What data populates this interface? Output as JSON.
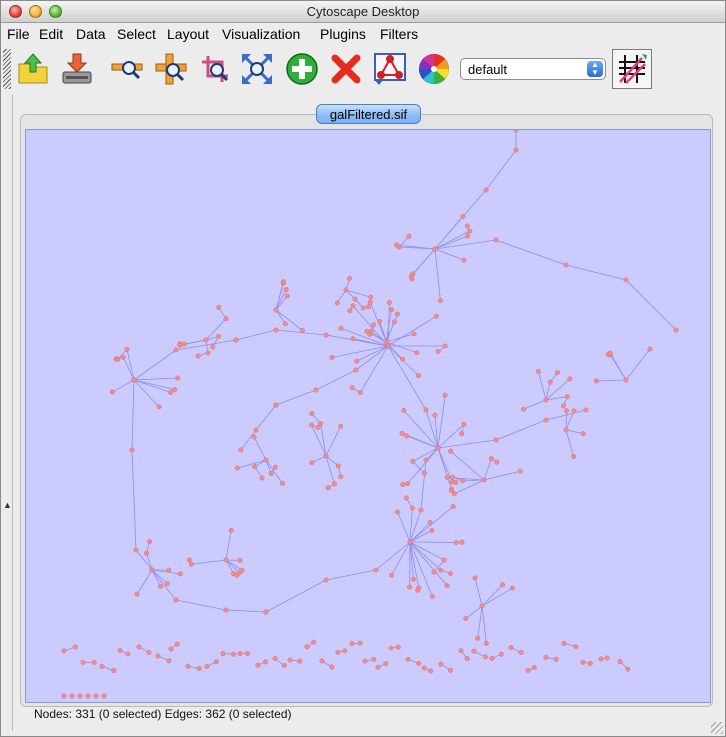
{
  "window": {
    "title": "Cytoscape Desktop"
  },
  "menu": [
    "File",
    "Edit",
    "Data",
    "Select",
    "Layout",
    "Visualization",
    "Plugins",
    "Filters"
  ],
  "toolbar": {
    "tools": [
      "open-session-icon",
      "save-session-icon",
      "zoom-out-icon",
      "zoom-in-icon",
      "zoom-selected-icon",
      "zoom-fit-icon",
      "create-network-icon",
      "destroy-network-icon",
      "network-editor-icon",
      "vizmapper-icon"
    ],
    "visual_style": "default",
    "right_tool": "show-hide-edges-icon"
  },
  "network_tab": {
    "label": "galFiltered.sif"
  },
  "status": "Nodes: 331 (0 selected) Edges: 362 (0 selected)",
  "colors": {
    "canvas_bg": "#cccbff",
    "node_fill": "#f08c8c",
    "edge": "#8c8cf0"
  }
}
